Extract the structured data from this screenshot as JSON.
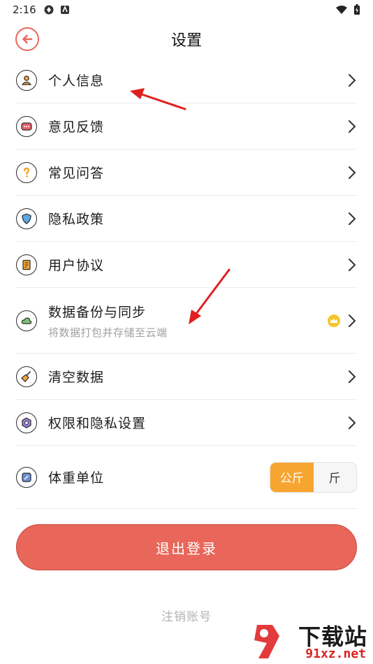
{
  "status_bar": {
    "time": "2:16"
  },
  "header": {
    "title": "设置"
  },
  "settings": {
    "items": [
      {
        "label": "个人信息",
        "icon": "user-icon"
      },
      {
        "label": "意见反馈",
        "icon": "feedback-icon"
      },
      {
        "label": "常见问答",
        "icon": "question-icon"
      },
      {
        "label": "隐私政策",
        "icon": "shield-icon"
      },
      {
        "label": "用户协议",
        "icon": "document-icon"
      },
      {
        "label": "数据备份与同步",
        "sublabel": "将数据打包并存储至云端",
        "icon": "cloud-icon",
        "badge": "crown-icon"
      },
      {
        "label": "清空数据",
        "icon": "broom-icon"
      },
      {
        "label": "权限和隐私设置",
        "icon": "settings-shield-icon"
      },
      {
        "label": "体重单位",
        "icon": "scale-icon"
      }
    ]
  },
  "weight_unit": {
    "options": [
      "公斤",
      "斤"
    ],
    "selected": "公斤"
  },
  "logout_label": "退出登录",
  "cancel_account_label": "注销账号",
  "watermark": {
    "top": "下载站",
    "bottom": "91xz.net"
  },
  "colors": {
    "accent": "#e8675a",
    "toggle_active": "#f7a531",
    "annotation_arrow": "#e02020"
  }
}
